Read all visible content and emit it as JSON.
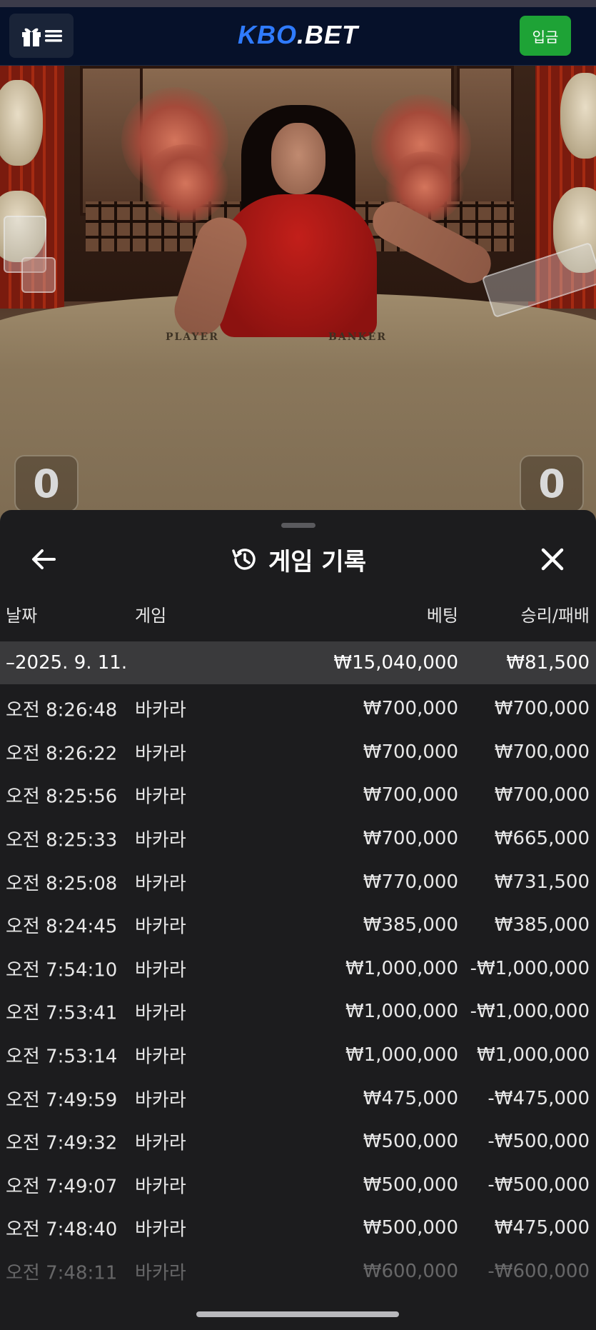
{
  "header": {
    "logo_prefix": "KBO",
    "logo_suffix": ".BET",
    "deposit_label": "입금"
  },
  "video": {
    "table_left_label": "PLAYER",
    "table_right_label": "BANKER",
    "player_score": "0",
    "banker_score": "0"
  },
  "sheet": {
    "title": "게임 기록",
    "columns": {
      "date": "날짜",
      "game": "게임",
      "bet": "베팅",
      "win_loss": "승리/패배"
    },
    "summary": {
      "date": "–2025. 9. 11.",
      "bet": "₩15,040,000",
      "win_loss": "₩81,500"
    },
    "rows": [
      {
        "time": "오전 8:26:48",
        "game": "바카라",
        "bet": "₩700,000",
        "win_loss": "₩700,000"
      },
      {
        "time": "오전 8:26:22",
        "game": "바카라",
        "bet": "₩700,000",
        "win_loss": "₩700,000"
      },
      {
        "time": "오전 8:25:56",
        "game": "바카라",
        "bet": "₩700,000",
        "win_loss": "₩700,000"
      },
      {
        "time": "오전 8:25:33",
        "game": "바카라",
        "bet": "₩700,000",
        "win_loss": "₩665,000"
      },
      {
        "time": "오전 8:25:08",
        "game": "바카라",
        "bet": "₩770,000",
        "win_loss": "₩731,500"
      },
      {
        "time": "오전 8:24:45",
        "game": "바카라",
        "bet": "₩385,000",
        "win_loss": "₩385,000"
      },
      {
        "time": "오전 7:54:10",
        "game": "바카라",
        "bet": "₩1,000,000",
        "win_loss": "-₩1,000,000"
      },
      {
        "time": "오전 7:53:41",
        "game": "바카라",
        "bet": "₩1,000,000",
        "win_loss": "-₩1,000,000"
      },
      {
        "time": "오전 7:53:14",
        "game": "바카라",
        "bet": "₩1,000,000",
        "win_loss": "₩1,000,000"
      },
      {
        "time": "오전 7:49:59",
        "game": "바카라",
        "bet": "₩475,000",
        "win_loss": "-₩475,000"
      },
      {
        "time": "오전 7:49:32",
        "game": "바카라",
        "bet": "₩500,000",
        "win_loss": "-₩500,000"
      },
      {
        "time": "오전 7:49:07",
        "game": "바카라",
        "bet": "₩500,000",
        "win_loss": "-₩500,000"
      },
      {
        "time": "오전 7:48:40",
        "game": "바카라",
        "bet": "₩500,000",
        "win_loss": "₩475,000"
      },
      {
        "time": "오전 7:48:11",
        "game": "바카라",
        "bet": "₩600,000",
        "win_loss": "-₩600,000"
      }
    ]
  }
}
